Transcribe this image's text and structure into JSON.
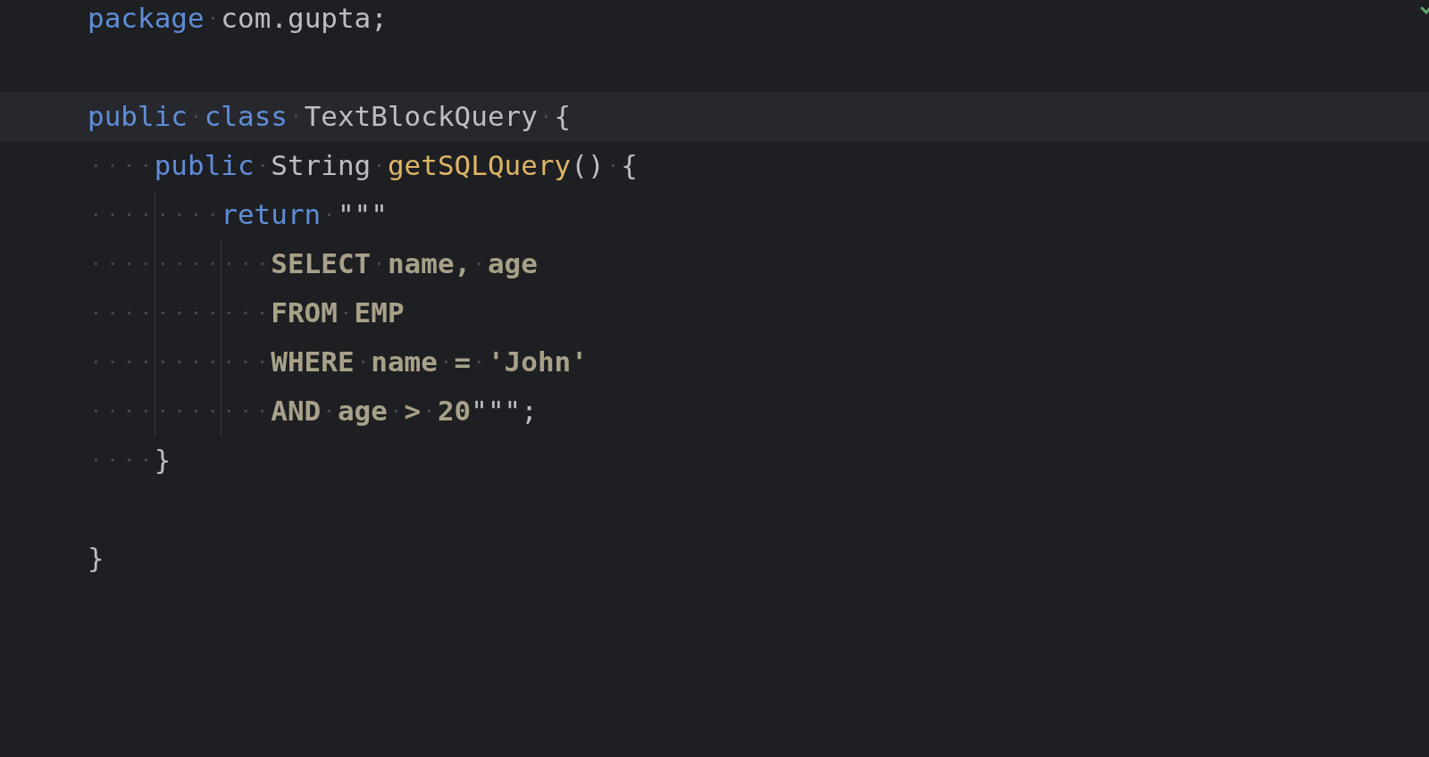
{
  "editor": {
    "status_ok": true,
    "lines": [
      {
        "current": false,
        "tokens": [
          {
            "kind": "keyword",
            "text": "package"
          },
          {
            "kind": "plain",
            "text": " com.gupta;"
          }
        ]
      },
      {
        "current": true,
        "blank_line_before": true,
        "tokens": [
          {
            "kind": "keyword",
            "text": "public class"
          },
          {
            "kind": "plain",
            "text": " TextBlockQuery {"
          }
        ]
      },
      {
        "current": false,
        "tokens": [
          {
            "kind": "keyword",
            "text": "    public"
          },
          {
            "kind": "plain",
            "text": " String "
          },
          {
            "kind": "method",
            "text": "getSQLQuery"
          },
          {
            "kind": "plain",
            "text": "() {"
          }
        ]
      },
      {
        "current": false,
        "tokens": [
          {
            "kind": "keyword",
            "text": "        return"
          },
          {
            "kind": "plain",
            "text": " \"\"\""
          }
        ]
      },
      {
        "current": false,
        "tokens": [
          {
            "kind": "sql",
            "text": "           SELECT name, age"
          }
        ]
      },
      {
        "current": false,
        "tokens": [
          {
            "kind": "sql",
            "text": "           FROM EMP"
          }
        ]
      },
      {
        "current": false,
        "tokens": [
          {
            "kind": "sql",
            "text": "           WHERE name = 'John'"
          }
        ]
      },
      {
        "current": false,
        "tokens": [
          {
            "kind": "sql",
            "text": "           AND age > 20"
          },
          {
            "kind": "plain",
            "text": "\"\"\";"
          }
        ]
      },
      {
        "current": false,
        "tokens": [
          {
            "kind": "plain",
            "text": "    }"
          }
        ]
      },
      {
        "current": false,
        "blank_line_before": true,
        "tokens": [
          {
            "kind": "plain",
            "text": "}"
          }
        ]
      }
    ]
  }
}
